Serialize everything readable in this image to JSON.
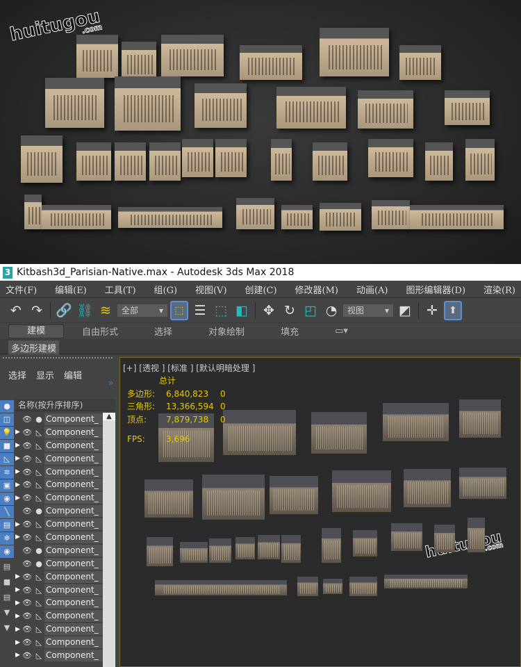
{
  "watermark": {
    "text": "huitugou",
    "com": ".com"
  },
  "window": {
    "title": "Kitbash3d_Parisian-Native.max - Autodesk 3ds Max 2018",
    "app_icon": "3"
  },
  "menu": [
    "文件(F)",
    "编辑(E)",
    "工具(T)",
    "组(G)",
    "视图(V)",
    "创建(C)",
    "修改器(M)",
    "动画(A)",
    "图形编辑器(D)",
    "渲染(R)"
  ],
  "toolbar": {
    "selection_filter": "全部",
    "reference_coord": "视图"
  },
  "ribbon": {
    "tabs": [
      "建模",
      "自由形式",
      "选择",
      "对象绘制",
      "填充"
    ],
    "active": "建模",
    "sub_panel": "多边形建模"
  },
  "scene_explorer": {
    "menu": [
      "选择",
      "显示",
      "编辑"
    ],
    "column_header": "名称(按升序排序)",
    "items": [
      {
        "name": "Component_",
        "type": "sphere",
        "expandable": false
      },
      {
        "name": "Component_",
        "type": "geometry",
        "expandable": true
      },
      {
        "name": "Component_",
        "type": "geometry",
        "expandable": true
      },
      {
        "name": "Component_",
        "type": "geometry",
        "expandable": true
      },
      {
        "name": "Component_",
        "type": "geometry",
        "expandable": true
      },
      {
        "name": "Component_",
        "type": "geometry",
        "expandable": true
      },
      {
        "name": "Component_",
        "type": "geometry",
        "expandable": true
      },
      {
        "name": "Component_",
        "type": "sphere",
        "expandable": false
      },
      {
        "name": "Component_",
        "type": "geometry",
        "expandable": true
      },
      {
        "name": "Component_",
        "type": "geometry",
        "expandable": true
      },
      {
        "name": "Component_",
        "type": "sphere",
        "expandable": false
      },
      {
        "name": "Component_",
        "type": "sphere",
        "expandable": false
      },
      {
        "name": "Component_",
        "type": "geometry",
        "expandable": true
      },
      {
        "name": "Component_",
        "type": "geometry",
        "expandable": true
      },
      {
        "name": "Component_",
        "type": "geometry",
        "expandable": true
      },
      {
        "name": "Component_",
        "type": "geometry",
        "expandable": true
      },
      {
        "name": "Component_",
        "type": "geometry",
        "expandable": true
      },
      {
        "name": "Component_",
        "type": "geometry",
        "expandable": true
      },
      {
        "name": "Component_",
        "type": "geometry",
        "expandable": true
      }
    ]
  },
  "viewport": {
    "label": "[+] [透视 ] [标准 ] [默认明暗处理 ]",
    "stats": {
      "header": "总计",
      "rows": [
        {
          "label": "多边形:",
          "total": "6,840,823",
          "selected": "0"
        },
        {
          "label": "三角形:",
          "total": "13,366,594",
          "selected": "0"
        },
        {
          "label": "顶点:",
          "total": "7,879,738",
          "selected": "0"
        }
      ],
      "fps_label": "FPS:",
      "fps": "3,696"
    }
  },
  "colors": {
    "accent": "#4b7fc4",
    "stats_text": "#e6c800",
    "ui_bg": "#444444"
  }
}
